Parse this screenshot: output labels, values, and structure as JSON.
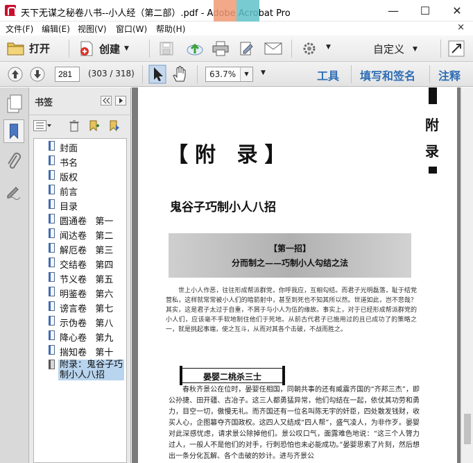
{
  "window": {
    "title": "天下无谋之秘卷八书--小人经（第二部）.pdf - Adobe Acrobat Pro",
    "minimize": "—",
    "maximize": "☐",
    "close": "✕"
  },
  "menu": {
    "items": [
      "文件(F)",
      "编辑(E)",
      "视图(V)",
      "窗口(W)",
      "帮助(H)"
    ],
    "close": "×"
  },
  "toolbar": {
    "open_label": "打开",
    "create_label": "创建",
    "customize_label": "自定义"
  },
  "nav": {
    "page_number": "281",
    "page_count": "(303 / 318)",
    "zoom": "63.7%",
    "links": [
      "工具",
      "填写和签名",
      "注释"
    ]
  },
  "bookmarks": {
    "title": "书签",
    "items": [
      {
        "label": "封面"
      },
      {
        "label": "书名"
      },
      {
        "label": "版权"
      },
      {
        "label": "前言"
      },
      {
        "label": "目录"
      },
      {
        "label": "圆通卷   第一"
      },
      {
        "label": "闻达卷   第二"
      },
      {
        "label": "解厄卷   第三"
      },
      {
        "label": "交结卷   第四"
      },
      {
        "label": "节义卷   第五"
      },
      {
        "label": "明鉴卷   第六"
      },
      {
        "label": "谤言卷   第七"
      },
      {
        "label": "示伪卷   第八"
      },
      {
        "label": "降心卷   第九"
      },
      {
        "label": "揣知卷   第十"
      },
      {
        "label": "附录：鬼谷子巧制小人八招",
        "selected": true
      }
    ]
  },
  "document": {
    "side_tab": [
      "附",
      "录"
    ],
    "appendix_title": "【附  录】",
    "section_title": "鬼谷子巧制小人八招",
    "banner_line1": "【第一招】",
    "banner_line2": "分而制之——巧制小人勾结之法",
    "intro_lines": "世上小人作恶，往往形成帮派群党，你呼我应，互相勾结。而君子光明磊落，耻于结党营私，这样就常常被小人们的暗箭射中，甚至到死也不知其所以然。世道如此，岂不悲哉？其实，这是君子太过于自重，不屑于与小人为伍的缘故。事实上，对于已经形成帮派群党的小人们，应该毫不手软地制住他们于死地。从前古代君子已施用过的且已成功了的策略之一，就是挑起事端，使之互斗，从而对其各个击破，不战而胜之。",
    "story_title": "晏婴二桃杀三士",
    "story_text": "春秋齐景公在位时，晏婴任相国，同朝共事的还有威震齐国的“齐邦三杰”，即公孙捷、田开疆、古冶子。这三人都勇猛异常，他们勾结在一起，依仗其功劳和勇力，目空一切，傲慢无礼。而齐国还有一位名叫陈无宇的奸臣，四处散发钱财，收买人心，企图篡夺齐国政权。这四人又结成“四人帮”，盛气凌人，为非作歹。晏婴对此深感忧虑，请求景公除掉他们。景公叹口气，面露难色地说：“这三个人膂力过人，一般人不是他们的对手，行刺恐怕也未必能成功。”晏婴思索了片刻，然后想出一条分化瓦解、各个击破的妙计。进与齐景公"
  }
}
